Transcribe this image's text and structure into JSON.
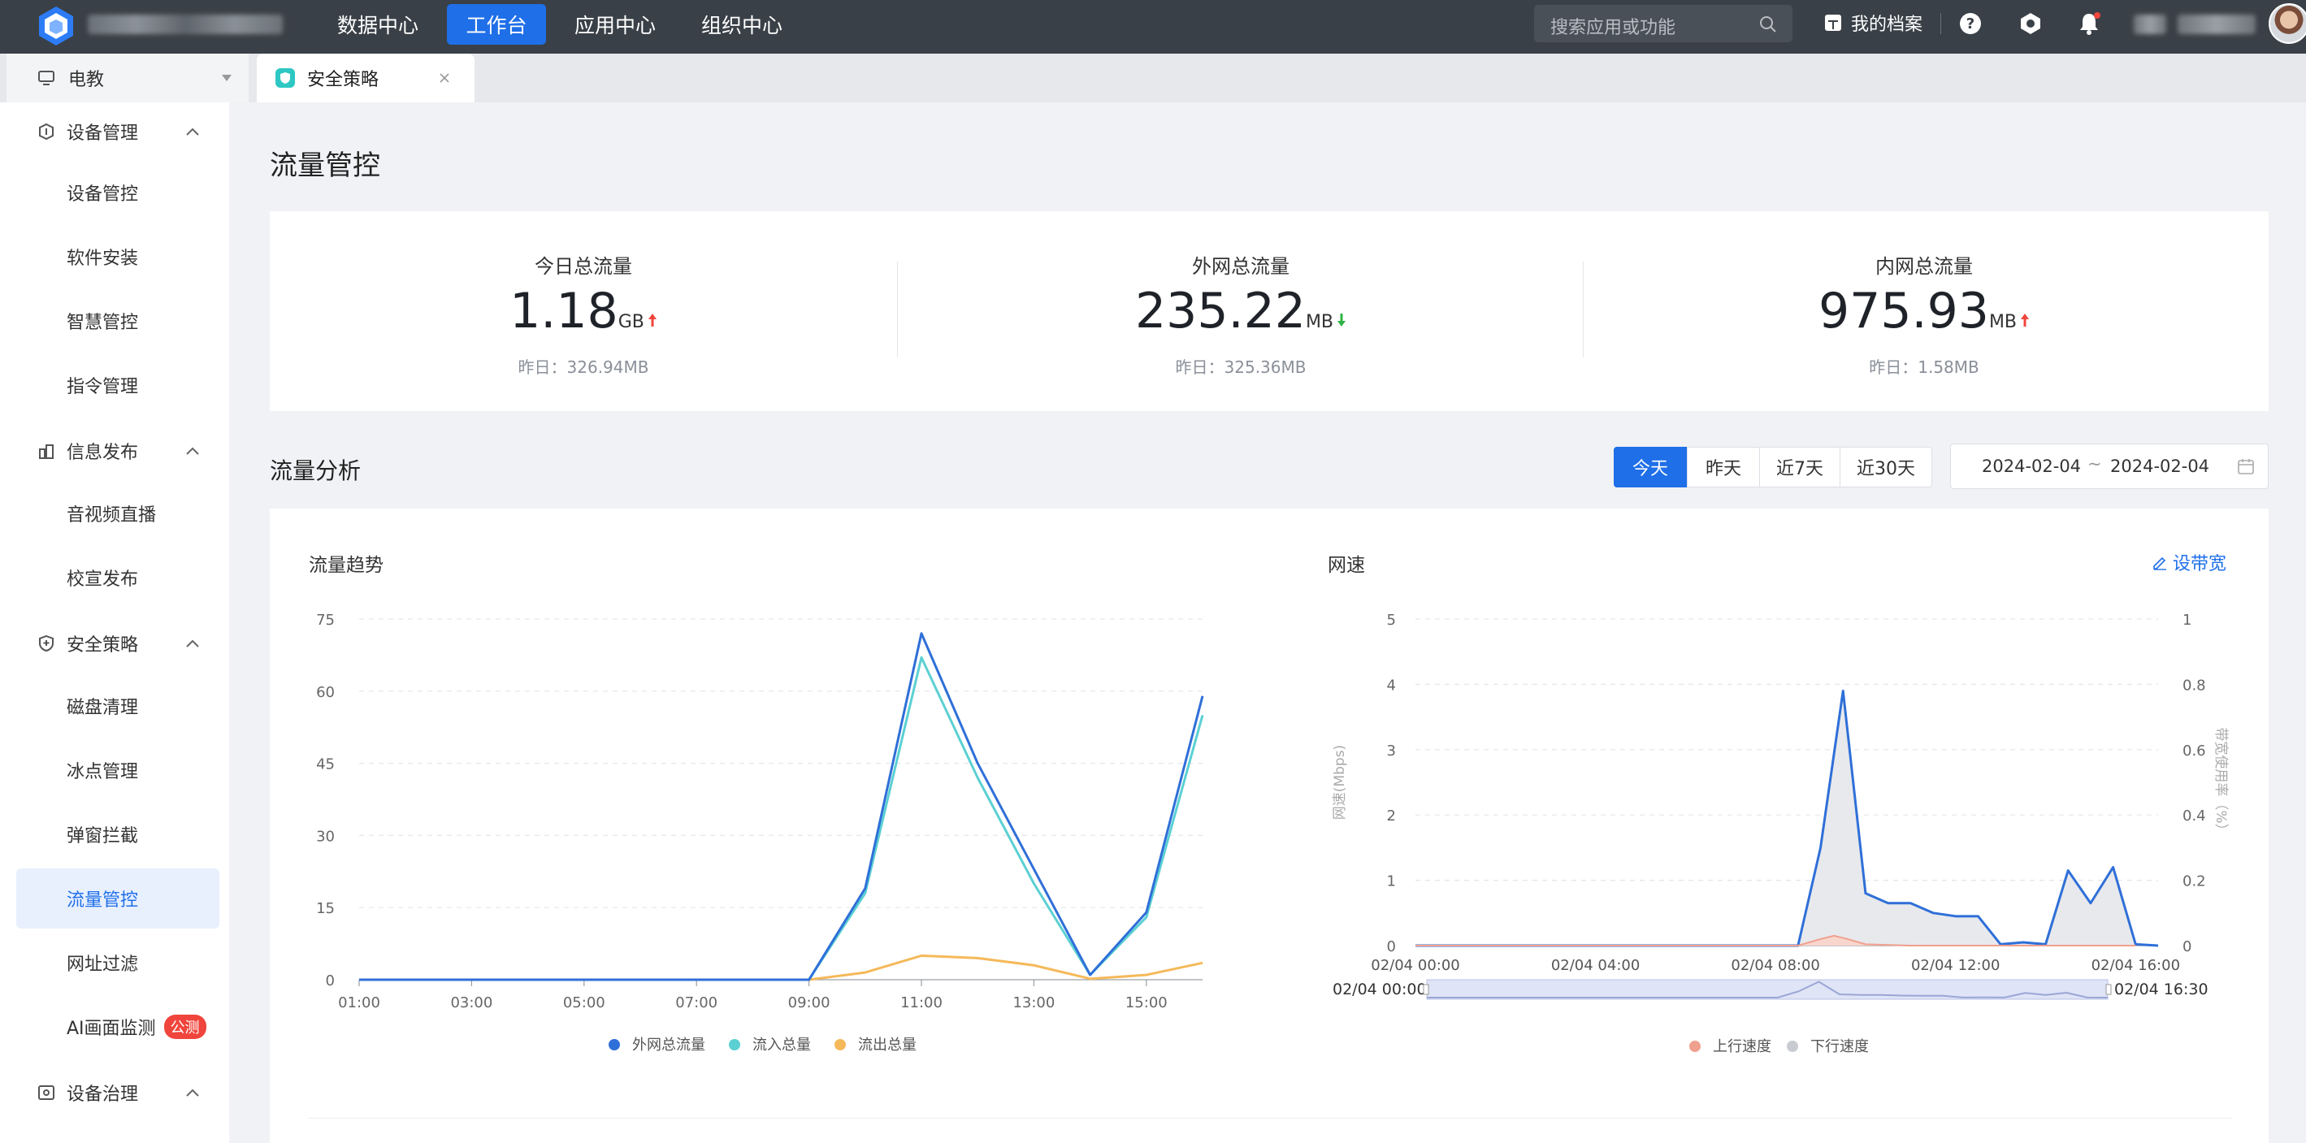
{
  "topbar": {
    "nav": [
      {
        "label": "数据中心",
        "active": false
      },
      {
        "label": "工作台",
        "active": true
      },
      {
        "label": "应用中心",
        "active": false
      },
      {
        "label": "组织中心",
        "active": false
      }
    ],
    "search_placeholder": "搜索应用或功能",
    "dossier_label": "我的档案",
    "accent_color": "#1f6fe8"
  },
  "tabbar": {
    "workspace_label": "电教",
    "tabs": [
      {
        "label": "安全策略",
        "icon": "shield-icon"
      }
    ]
  },
  "sidebar": {
    "groups": [
      {
        "label": "设备管理",
        "icon": "device-icon",
        "items": [
          "设备管控",
          "软件安装",
          "智慧管控",
          "指令管理"
        ]
      },
      {
        "label": "信息发布",
        "icon": "publish-icon",
        "items": [
          "音视频直播",
          "校宣发布"
        ]
      },
      {
        "label": "安全策略",
        "icon": "shield-icon",
        "items": [
          "磁盘清理",
          "冰点管理",
          "弹窗拦截",
          "流量管控",
          "网址过滤",
          "AI画面监测"
        ]
      },
      {
        "label": "设备治理",
        "icon": "govern-icon",
        "items": []
      }
    ],
    "active_item": "流量管控",
    "badge_label": "公测"
  },
  "page": {
    "title": "流量管控"
  },
  "stats": [
    {
      "label": "今日总流量",
      "value": "1.18",
      "unit": "GB",
      "trend": "up",
      "yesterday": "昨日：326.94MB"
    },
    {
      "label": "外网总流量",
      "value": "235.22",
      "unit": "MB",
      "trend": "down",
      "yesterday": "昨日：325.36MB"
    },
    {
      "label": "内网总流量",
      "value": "975.93",
      "unit": "MB",
      "trend": "up",
      "yesterday": "昨日：1.58MB"
    }
  ],
  "analysis": {
    "title": "流量分析",
    "ranges": [
      "今天",
      "昨天",
      "近7天",
      "近30天"
    ],
    "active_range": "今天",
    "date_start": "2024-02-04",
    "date_sep": "~",
    "date_end": "2024-02-04",
    "edit_label": "设带宽"
  },
  "chart_data": [
    {
      "type": "line",
      "title": "流量趋势",
      "x": [
        "01:00",
        "02:00",
        "03:00",
        "04:00",
        "05:00",
        "06:00",
        "07:00",
        "08:00",
        "09:00",
        "10:00",
        "11:00",
        "12:00",
        "13:00",
        "14:00",
        "15:00",
        "16:00"
      ],
      "xticks": [
        "01:00",
        "03:00",
        "05:00",
        "07:00",
        "09:00",
        "11:00",
        "13:00",
        "15:00"
      ],
      "ylim": [
        0,
        75
      ],
      "yticks": [
        0,
        15,
        30,
        45,
        60,
        75
      ],
      "series": [
        {
          "name": "外网总流量",
          "color": "#2f6fd8",
          "values": [
            0,
            0,
            0,
            0,
            0,
            0,
            0,
            0,
            0,
            19,
            72,
            45,
            23,
            1,
            14,
            59
          ]
        },
        {
          "name": "流入总量",
          "color": "#5bd0d3",
          "values": [
            0,
            0,
            0,
            0,
            0,
            0,
            0,
            0,
            0,
            18,
            67,
            42,
            20,
            1,
            13,
            55
          ]
        },
        {
          "name": "流出总量",
          "color": "#f5b95a",
          "values": [
            0,
            0,
            0,
            0,
            0,
            0,
            0,
            0,
            0,
            1.5,
            5,
            4.5,
            3,
            0.2,
            1,
            3.5
          ]
        }
      ],
      "legend": "bottom"
    },
    {
      "type": "area",
      "title": "网速",
      "ylabel": "网速(Mbps)",
      "y2label": "带宽使用率（%）",
      "xticks": [
        "02/04 00:00",
        "02/04 04:00",
        "02/04 08:00",
        "02/04 12:00",
        "02/04 16:00"
      ],
      "xlim_hours": [
        0,
        16.5
      ],
      "ylim": [
        0,
        5
      ],
      "yticks": [
        0,
        1,
        2,
        3,
        4,
        5
      ],
      "y2ticks": [
        "0",
        "0.2",
        "0.4",
        "0.6",
        "0.8",
        "1"
      ],
      "slider_start": "02/04 00:00",
      "slider_end": "02/04 16:30",
      "series": [
        {
          "name": "上行速度",
          "color": "#f0a08e",
          "x_hours": [
            0,
            8.5,
            9,
            9.3,
            9.6,
            10,
            11,
            16
          ],
          "values": [
            0,
            0,
            0.1,
            0.15,
            0.1,
            0.02,
            0,
            0
          ]
        },
        {
          "name": "下行速度",
          "color": "#c8cbd0",
          "line_color": "#2f6fd8",
          "x_hours": [
            0,
            8.5,
            9,
            9.5,
            10,
            10.5,
            11,
            11.5,
            12,
            12.5,
            13,
            13.5,
            14,
            14.5,
            15,
            15.5,
            16,
            16.5
          ],
          "values": [
            0,
            0,
            1.5,
            3.9,
            0.8,
            0.65,
            0.65,
            0.5,
            0.45,
            0.45,
            0.02,
            0.05,
            0.02,
            1.15,
            0.65,
            1.2,
            0.02,
            0
          ]
        }
      ],
      "legend": "bottom"
    }
  ]
}
